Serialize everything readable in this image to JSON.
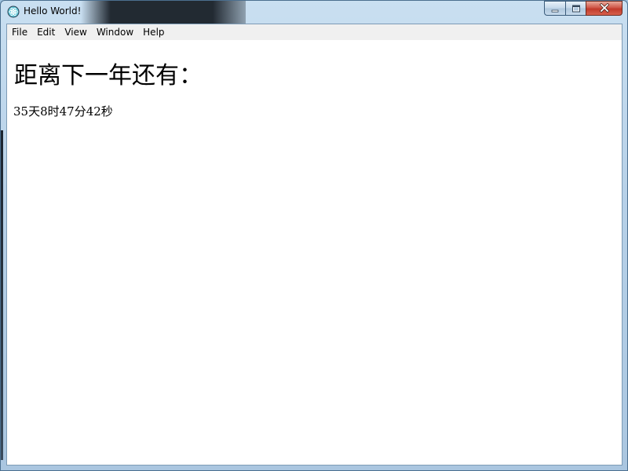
{
  "window": {
    "title": "Hello World!",
    "app_icon": "electron-atom-icon",
    "controls": {
      "minimize_icon": "minimize-icon",
      "maximize_icon": "maximize-icon",
      "close_icon": "close-icon"
    }
  },
  "menubar": {
    "items": [
      {
        "label": "File"
      },
      {
        "label": "Edit"
      },
      {
        "label": "View"
      },
      {
        "label": "Window"
      },
      {
        "label": "Help"
      }
    ]
  },
  "main": {
    "heading": "距离下一年还有：",
    "countdown": "35天8时47分42秒"
  },
  "colors": {
    "titlebar": "#b7d1e8",
    "close_button": "#c13a2b",
    "menubar_bg": "#f0f0f0",
    "content_bg": "#ffffff"
  }
}
